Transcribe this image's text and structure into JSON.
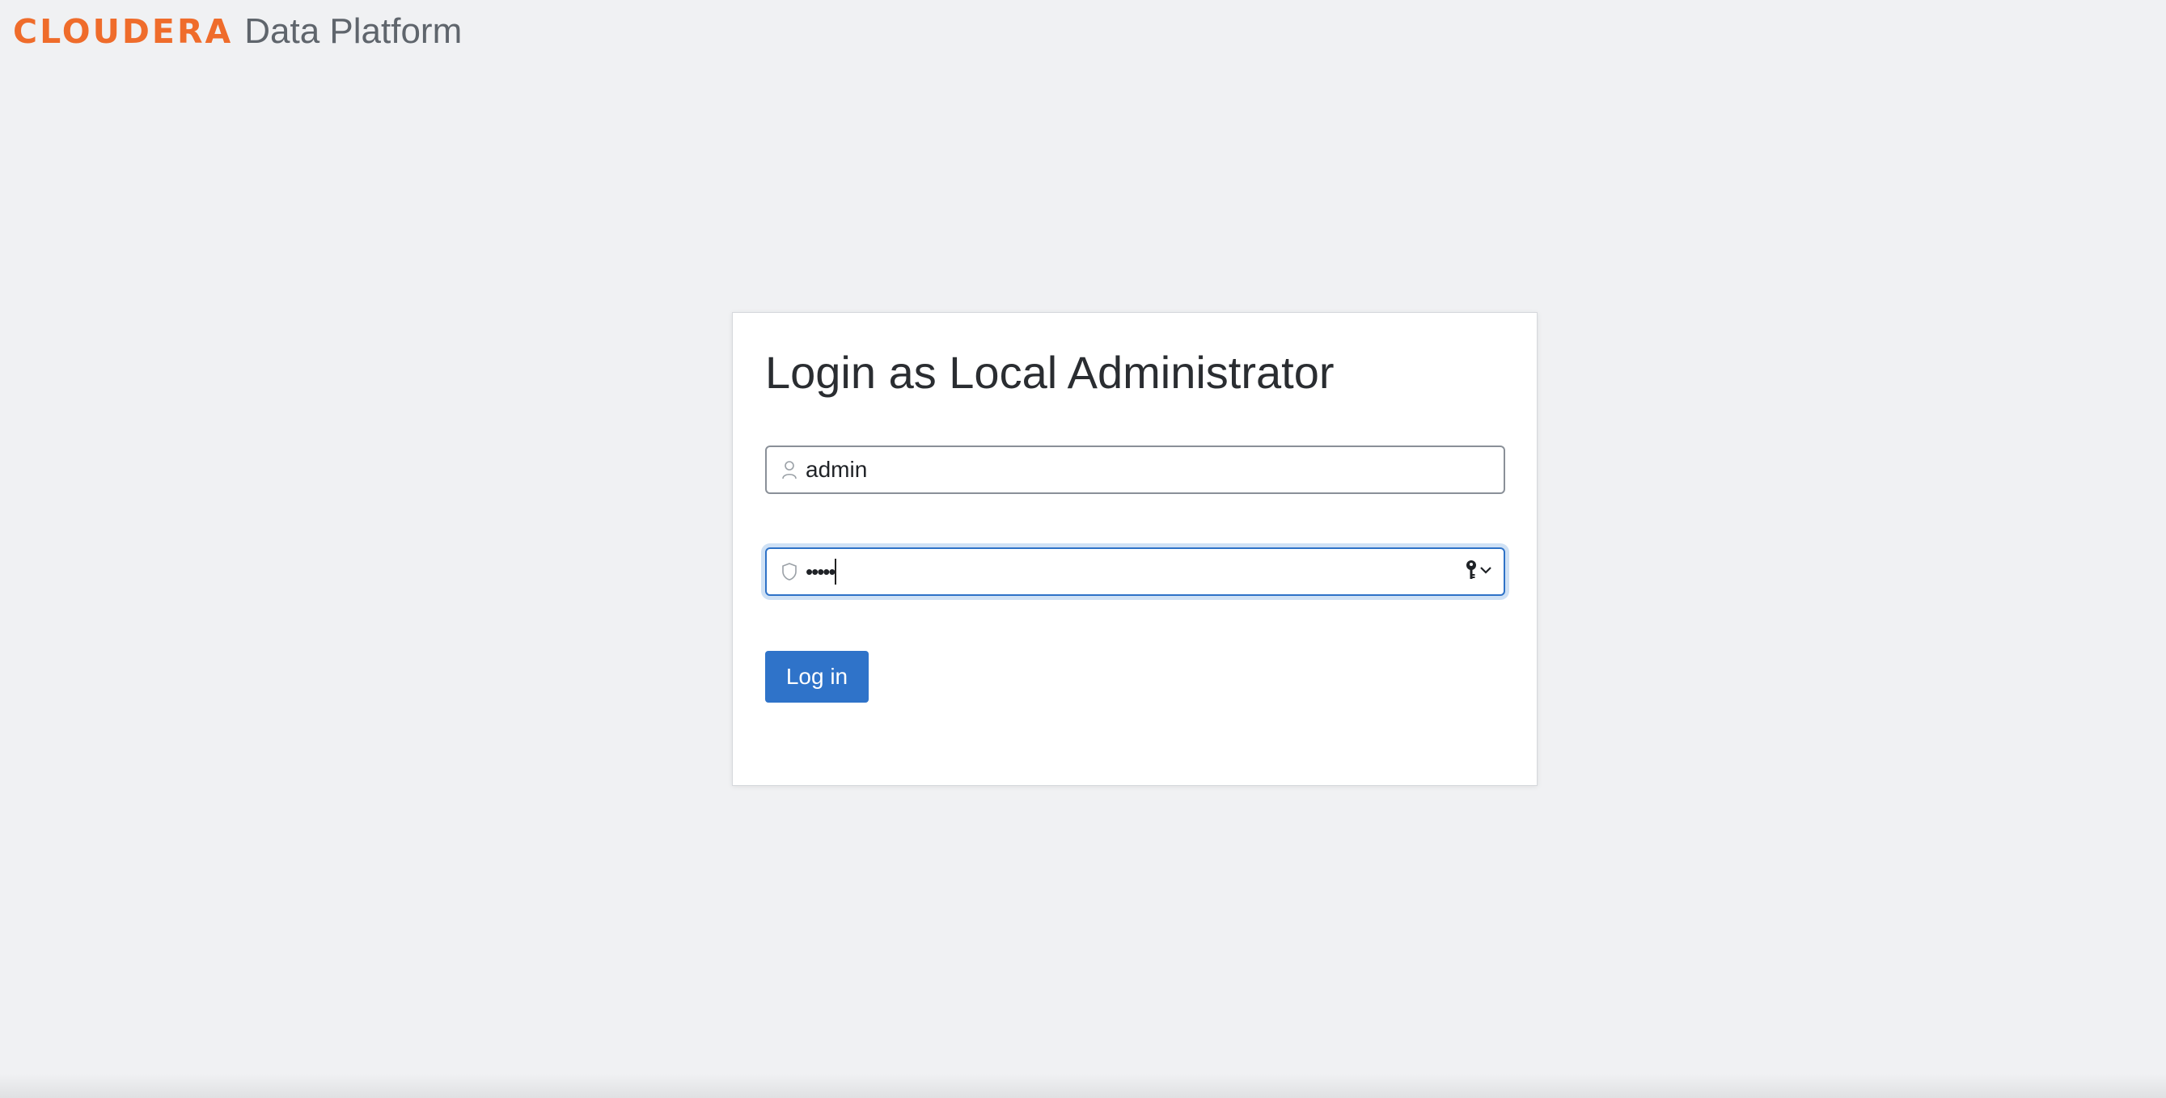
{
  "header": {
    "logo_text": "CLOUDERA",
    "product_name": "Data Platform",
    "brand_color": "#ef6c2b"
  },
  "login": {
    "title": "Login as Local Administrator",
    "username": {
      "value": "admin",
      "icon": "user-icon"
    },
    "password": {
      "masked_value": "•••••",
      "icon": "shield-icon",
      "manager_icon": "key-icon",
      "manager_dropdown_icon": "chevron-down-icon"
    },
    "submit_label": "Log in"
  },
  "colors": {
    "background": "#f0f1f3",
    "primary_button": "#2f73c9",
    "focus_border": "#2e72c7"
  }
}
